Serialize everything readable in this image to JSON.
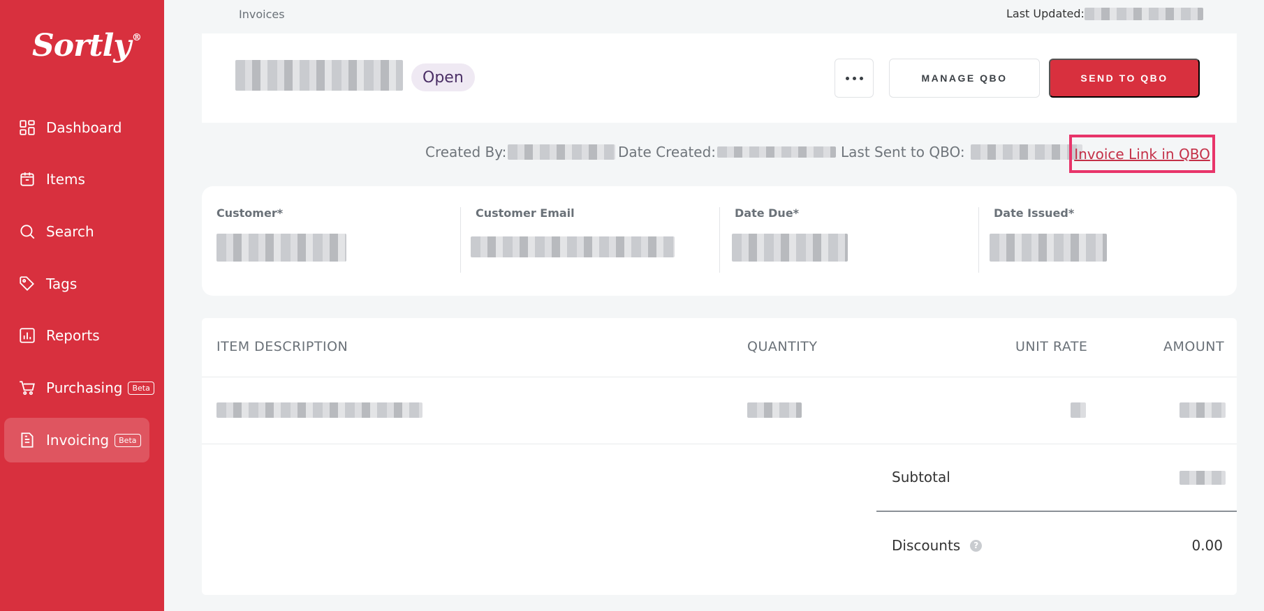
{
  "sidebar": {
    "logo": "Sortly",
    "logo_mark": "®",
    "items": [
      {
        "label": "Dashboard",
        "icon": "dashboard-icon"
      },
      {
        "label": "Items",
        "icon": "items-icon"
      },
      {
        "label": "Search",
        "icon": "search-icon"
      },
      {
        "label": "Tags",
        "icon": "tag-icon"
      },
      {
        "label": "Reports",
        "icon": "reports-icon"
      },
      {
        "label": "Purchasing",
        "icon": "cart-icon",
        "badge": "Beta"
      },
      {
        "label": "Invoicing",
        "icon": "invoice-icon",
        "badge": "Beta",
        "active": true
      }
    ]
  },
  "topbar": {
    "breadcrumb": "Invoices",
    "last_updated_label": "Last Updated:"
  },
  "header": {
    "status": "Open",
    "more_label": "More options",
    "manage_label": "MANAGE QBO",
    "send_label": "SEND TO QBO"
  },
  "meta": {
    "created_by_label": "Created By:",
    "date_created_label": "Date Created:",
    "last_sent_label": "Last Sent to QBO:",
    "invoice_link_label": "Invoice Link in QBO"
  },
  "fields": [
    {
      "label": "Customer*"
    },
    {
      "label": "Customer Email"
    },
    {
      "label": "Date Due*"
    },
    {
      "label": "Date Issued*"
    }
  ],
  "table": {
    "headers": {
      "description": "ITEM DESCRIPTION",
      "quantity": "QUANTITY",
      "unit_rate": "UNIT RATE",
      "amount": "AMOUNT"
    }
  },
  "summary": {
    "subtotal_label": "Subtotal",
    "discounts_label": "Discounts",
    "discounts_value": "0.00",
    "help_icon_glyph": "?"
  },
  "colors": {
    "brand": "#d8303e",
    "highlight": "#e8356a",
    "status_bg": "#efe9f3"
  }
}
